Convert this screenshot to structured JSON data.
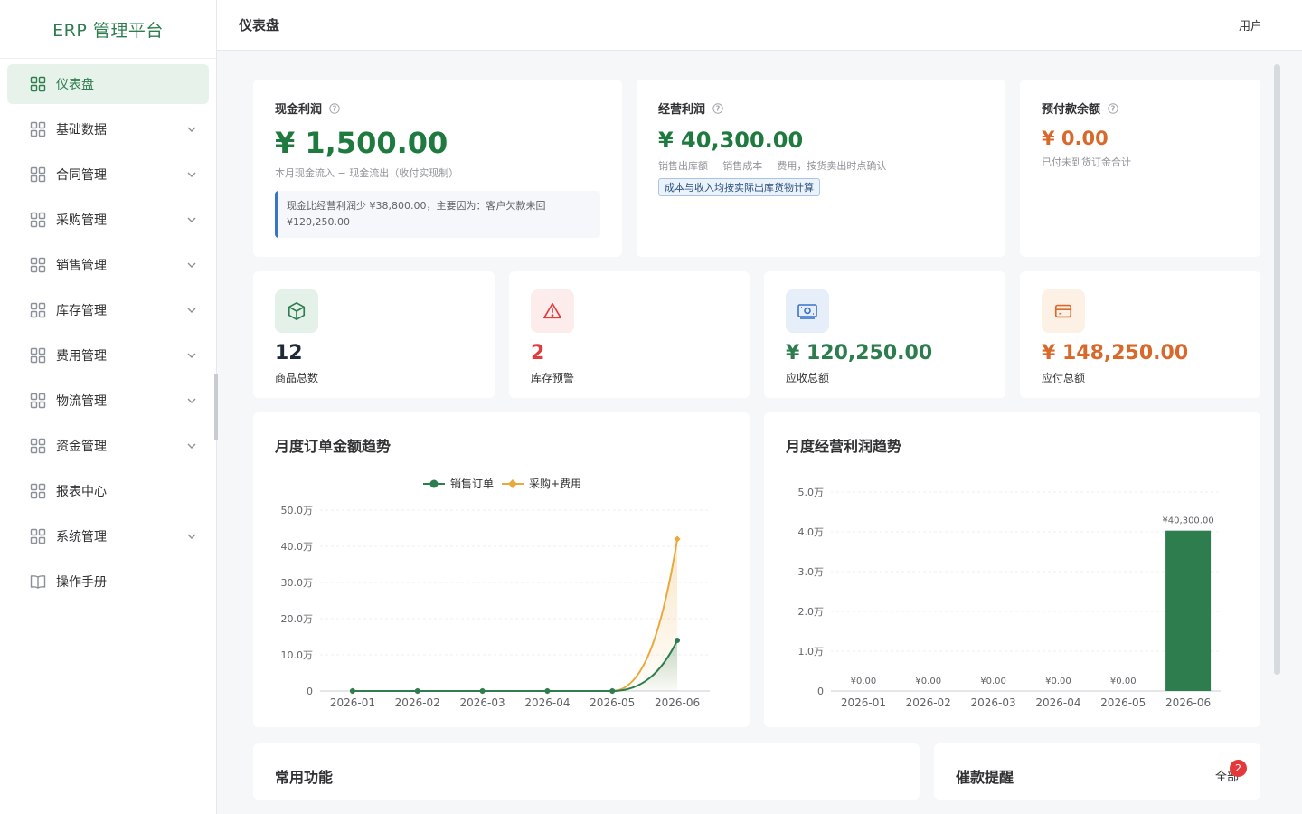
{
  "app": {
    "title": "ERP 管理平台"
  },
  "header": {
    "title": "仪表盘",
    "user": "用户"
  },
  "sidebar": {
    "items": [
      {
        "label": "仪表盘",
        "icon": "grid-icon",
        "active": true,
        "has_children": false
      },
      {
        "label": "基础数据",
        "icon": "grid-icon",
        "has_children": true
      },
      {
        "label": "合同管理",
        "icon": "grid-icon",
        "has_children": true
      },
      {
        "label": "采购管理",
        "icon": "grid-icon",
        "has_children": true
      },
      {
        "label": "销售管理",
        "icon": "grid-icon",
        "has_children": true
      },
      {
        "label": "库存管理",
        "icon": "grid-icon",
        "has_children": true
      },
      {
        "label": "费用管理",
        "icon": "grid-icon",
        "has_children": true
      },
      {
        "label": "物流管理",
        "icon": "grid-icon",
        "has_children": true
      },
      {
        "label": "资金管理",
        "icon": "grid-icon",
        "has_children": true
      },
      {
        "label": "报表中心",
        "icon": "grid-icon",
        "has_children": false
      },
      {
        "label": "系统管理",
        "icon": "grid-icon",
        "has_children": true
      },
      {
        "label": "操作手册",
        "icon": "book-icon",
        "has_children": false
      }
    ]
  },
  "kpis": {
    "cash_profit": {
      "label": "现金利润",
      "value": "¥ 1,500.00",
      "sub": "本月现金流入 − 现金流出（收付实现制）",
      "note": "现金比经营利润少 ¥38,800.00，主要因为：客户欠款未回 ¥120,250.00"
    },
    "operating_profit": {
      "label": "经营利润",
      "value": "¥ 40,300.00",
      "sub": "销售出库额 − 销售成本 − 费用，按货卖出时点确认",
      "tag": "成本与收入均按实际出库货物计算"
    },
    "prepaid_balance": {
      "label": "预付款余额",
      "value": "¥ 0.00",
      "sub": "已付未到货订金合计"
    }
  },
  "stats": [
    {
      "value": "12",
      "label": "商品总数",
      "icon": "box-icon",
      "color": "#1f2937"
    },
    {
      "value": "2",
      "label": "库存预警",
      "icon": "warning-icon",
      "color": "#e03c3c"
    },
    {
      "value": "¥ 120,250.00",
      "label": "应收总额",
      "icon": "cash-icon",
      "color": "#2e7d4f"
    },
    {
      "value": "¥ 148,250.00",
      "label": "应付总额",
      "icon": "card-icon",
      "color": "#d9682b"
    }
  ],
  "colors": {
    "primary": "#2e7d4f",
    "sales": "#2e7d4f",
    "purchase": "#e9a93c",
    "danger": "#e03c3c",
    "payable": "#d9682b"
  },
  "chart_data": [
    {
      "type": "line",
      "title": "月度订单金额趋势",
      "categories": [
        "2026-01",
        "2026-02",
        "2026-03",
        "2026-04",
        "2026-05",
        "2026-06"
      ],
      "yticks": [
        "0",
        "10.0万",
        "20.0万",
        "30.0万",
        "40.0万",
        "50.0万"
      ],
      "ylim": [
        0,
        500000
      ],
      "legend": "top-center",
      "series": [
        {
          "name": "销售订单",
          "values": [
            0,
            0,
            0,
            0,
            0,
            140000
          ]
        },
        {
          "name": "采购+费用",
          "values": [
            0,
            0,
            0,
            0,
            0,
            420000
          ]
        }
      ]
    },
    {
      "type": "bar",
      "title": "月度经营利润趋势",
      "categories": [
        "2026-01",
        "2026-02",
        "2026-03",
        "2026-04",
        "2026-05",
        "2026-06"
      ],
      "yticks": [
        "0",
        "1.0万",
        "2.0万",
        "3.0万",
        "4.0万",
        "5.0万"
      ],
      "ylim": [
        0,
        50000
      ],
      "values": [
        0,
        0,
        0,
        0,
        0,
        40300
      ],
      "value_labels": [
        "¥0.00",
        "¥0.00",
        "¥0.00",
        "¥0.00",
        "¥0.00",
        "¥40,300.00"
      ]
    }
  ],
  "bottom": {
    "quick_title": "常用功能",
    "reminder_title": "催款提醒",
    "reminder_link": "全部",
    "reminder_count": "2"
  }
}
